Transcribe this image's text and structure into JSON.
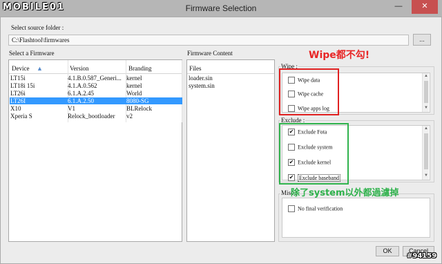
{
  "watermark_logo": "MOBILE01",
  "window": {
    "title": "Firmware Selection",
    "minimize": "—",
    "close": "✕"
  },
  "source": {
    "label": "Select source folder :",
    "value": "C:\\Flashtool\\firmwares",
    "browse_label": "..."
  },
  "firmware": {
    "label": "Select a Firmware",
    "columns": [
      "Device",
      "Version",
      "Branding"
    ],
    "rows": [
      {
        "device": "LT15i",
        "version": "4.1.B.0.587_Generi...",
        "branding": "kernel"
      },
      {
        "device": "LT18i 15i",
        "version": "4.1.A.0.562",
        "branding": "kernel"
      },
      {
        "device": "LT26i",
        "version": "6.1.A.2.45",
        "branding": "World"
      },
      {
        "device": "LT26I",
        "version": "6.1.A.2.50",
        "branding": "8080-SG"
      },
      {
        "device": "X10",
        "version": "V1",
        "branding": "BLRelock"
      },
      {
        "device": "Xperia S",
        "version": "Relock_bootloader",
        "branding": "v2"
      }
    ],
    "selected_index": 3
  },
  "content": {
    "label": "Firmware Content",
    "header": "Files",
    "files": [
      "loader.sin",
      "system.sin"
    ]
  },
  "wipe": {
    "label": "Wipe :",
    "options": [
      {
        "label": "Wipe data",
        "checked": false
      },
      {
        "label": "Wipe cache",
        "checked": false
      },
      {
        "label": "Wipe apps log",
        "checked": false
      }
    ]
  },
  "exclude": {
    "label": "Exclude :",
    "options": [
      {
        "label": "Exclude Fota",
        "checked": true
      },
      {
        "label": "Exclude system",
        "checked": false
      },
      {
        "label": "Exclude kernel",
        "checked": true
      },
      {
        "label": "Exclude baseband",
        "checked": true
      }
    ]
  },
  "misc": {
    "label": "Misc :",
    "options": [
      {
        "label": "No final verification",
        "checked": false
      }
    ]
  },
  "annotations": {
    "wipe_note": "Wipe都不勾!",
    "exclude_note": "除了system以外都過濾掉",
    "red": "#e02020",
    "green": "#2fb24c"
  },
  "buttons": {
    "ok": "OK",
    "cancel": "Cancel"
  },
  "watermark_id": "#94159",
  "colors": {
    "selection": "#3399ff",
    "close_button": "#c75050"
  }
}
